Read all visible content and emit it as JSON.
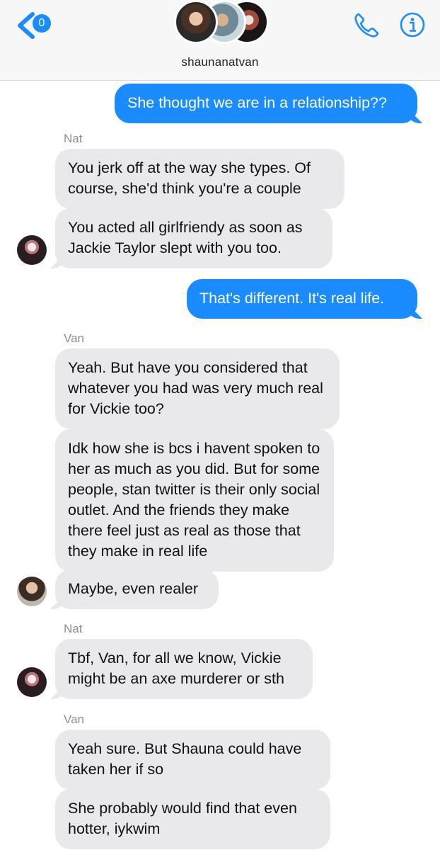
{
  "header": {
    "back_badge_count": "0",
    "group_name": "shaunanatvan",
    "avatars": [
      "Shauna",
      "Nat",
      "Van"
    ]
  },
  "colors": {
    "accent": "#1a8cff",
    "incoming_bubble": "#e9e9eb",
    "sender_label": "#8e8e93"
  },
  "thread": {
    "messages": [
      {
        "direction": "out",
        "text": "She thought we are in a relationship??"
      },
      {
        "sender": "Nat",
        "direction": "in",
        "text": "You jerk off at the way she types. Of course, she'd think you're a couple"
      },
      {
        "direction": "in",
        "text": "You acted all girlfriendy as soon as Jackie Taylor slept with you too."
      },
      {
        "direction": "out",
        "text": "That's different. It's real life."
      },
      {
        "sender": "Van",
        "direction": "in",
        "text": "Yeah. But have you considered that whatever you had was very much real for Vickie too?"
      },
      {
        "direction": "in",
        "text": "Idk how she is bcs i havent spoken to her as much as you did. But for some people, stan twitter is their only social outlet. And the friends they make there feel just as real as those that they make in real life"
      },
      {
        "direction": "in",
        "text": "Maybe, even realer"
      },
      {
        "sender": "Nat",
        "direction": "in",
        "text": "Tbf, Van, for all we know, Vickie might be an axe murderer or sth"
      },
      {
        "sender": "Van",
        "direction": "in",
        "text": "Yeah sure. But Shauna could have taken her if so"
      },
      {
        "direction": "in",
        "text": "She probably would find that even hotter, iykwim"
      }
    ]
  }
}
